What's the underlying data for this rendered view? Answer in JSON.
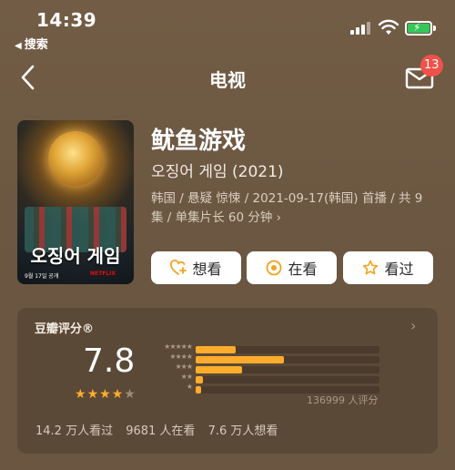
{
  "status_bar": {
    "time": "14:39",
    "back_app": "搜索"
  },
  "nav": {
    "title": "电视",
    "mail_badge": "13"
  },
  "poster": {
    "korean_title": "오징어 게임",
    "date_text": "9월 17일 공개",
    "brand": "NETFLIX"
  },
  "show": {
    "title": "鱿鱼游戏",
    "subtitle": "오징어 게임 (2021)",
    "meta": "韩国 / 悬疑 惊悚 / 2021-09-17(韩国) 首播 / 共 9 集 / 单集片长 60 分钟 ›"
  },
  "actions": {
    "want": "想看",
    "watching": "在看",
    "watched": "看过"
  },
  "rating": {
    "label": "豆瓣评分®",
    "score": "7.8",
    "stars_full": 4,
    "stars_total": 5,
    "distribution": [
      {
        "stars": "★★★★★",
        "percent": 22
      },
      {
        "stars": "★★★★",
        "percent": 48
      },
      {
        "stars": "★★★",
        "percent": 25
      },
      {
        "stars": "★★",
        "percent": 4
      },
      {
        "stars": "★",
        "percent": 3
      }
    ],
    "count": "136999 人评分",
    "watched": "14.2 万人看过",
    "watching": "9681 人在看",
    "want": "7.6 万人想看"
  },
  "colors": {
    "accent": "#ffac2d",
    "badge": "#f0524a",
    "background": "#6e5a44"
  }
}
